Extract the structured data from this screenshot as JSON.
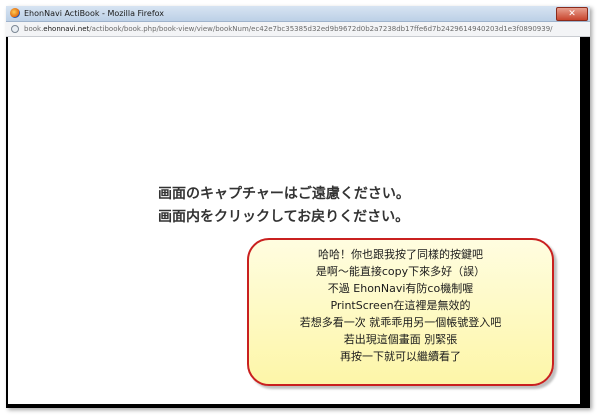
{
  "window": {
    "title": "EhonNavi ActiBook - Mozilla Firefox",
    "close_glyph": "✕"
  },
  "addressbar": {
    "url_prefix": "book.",
    "url_domain": "ehonnavi.net",
    "url_path": "/actibook/book.php/book-view/view/bookNum/ec42e7bc35385d32ed9b9672d0b2a7238db17ffe6d7b2429614940203d1e3f0890939/"
  },
  "message": {
    "line1": "画面のキャプチャーはご遠慮ください。",
    "line2": "画面内をクリックしてお戻りください。"
  },
  "callout": {
    "lines": [
      "哈哈！你也跟我按了同樣的按鍵吧",
      "是啊～能直接copy下來多好（誤）",
      "不過  EhonNavi有防co機制喔",
      "PrintScreen在這裡是無效的",
      "若想多看一次  就乖乖用另一個帳號登入吧",
      "若出現這個畫面  別緊張",
      "再按一下就可以繼續看了"
    ],
    "border_color": "#c9201f",
    "fill_color": "#fdf6a8"
  }
}
